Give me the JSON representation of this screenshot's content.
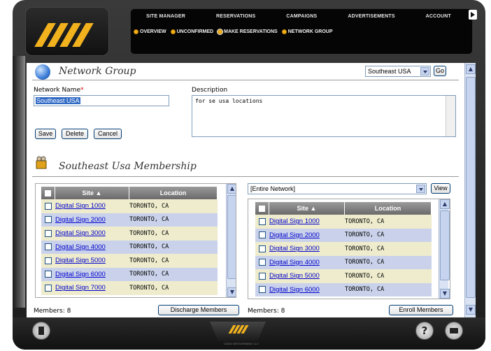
{
  "brand": {
    "accent": "#f2b21e",
    "logo_icon": "brand-stripes-logo"
  },
  "nav": {
    "menu": [
      "SITE MANAGER",
      "RESERVATIONS",
      "CAMPAIGNS",
      "ADVERTISEMENTS",
      "ACCOUNT"
    ],
    "submenu": [
      "OVERVIEW",
      "UNCONFIRMED",
      "MAKE RESERVATIONS",
      "NETWORK GROUP"
    ]
  },
  "header": {
    "title": "Network Group",
    "network_select": "Southeast USA",
    "go_label": "Go"
  },
  "form": {
    "name_label": "Network Name",
    "required_mark": "*",
    "name_value": "Southeast USA",
    "description_label": "Description",
    "description_value": "for se usa locations",
    "save_label": "Save",
    "delete_label": "Delete",
    "cancel_label": "Cancel"
  },
  "membership": {
    "title": "Southeast Usa Membership",
    "filter_select": "[Entire Network]",
    "view_label": "View",
    "left_table": {
      "columns": [
        "Site ▲",
        "Location"
      ],
      "rows": [
        {
          "site": "Digital Sign 1000",
          "location": "TORONTO, CA"
        },
        {
          "site": "Digital Sign 2000",
          "location": "TORONTO, CA"
        },
        {
          "site": "Digital Sign 3000",
          "location": "TORONTO, CA"
        },
        {
          "site": "Digital Sign 4000",
          "location": "TORONTO, CA"
        },
        {
          "site": "Digital Sign 5000",
          "location": "TORONTO, CA"
        },
        {
          "site": "Digital Sign 6000",
          "location": "TORONTO, CA"
        },
        {
          "site": "Digital Sign 7000",
          "location": "TORONTO, CA"
        }
      ]
    },
    "right_table": {
      "columns": [
        "Site ▲",
        "Location"
      ],
      "rows": [
        {
          "site": "Digital Sign 1000",
          "location": "TORONTO, CA"
        },
        {
          "site": "Digital Sign 2000",
          "location": "TORONTO, CA"
        },
        {
          "site": "Digital Sign 3000",
          "location": "TORONTO, CA"
        },
        {
          "site": "Digital Sign 4000",
          "location": "TORONTO, CA"
        },
        {
          "site": "Digital Sign 5000",
          "location": "TORONTO, CA"
        },
        {
          "site": "Digital Sign 6000",
          "location": "TORONTO, CA"
        }
      ]
    },
    "left_count": "Members: 8",
    "right_count": "Members: 8",
    "discharge_label": "Discharge Members",
    "enroll_label": "Enroll Members"
  },
  "footer": {
    "help_glyph": "?",
    "copyright": "©2005 INFOVERMENT LLC"
  }
}
